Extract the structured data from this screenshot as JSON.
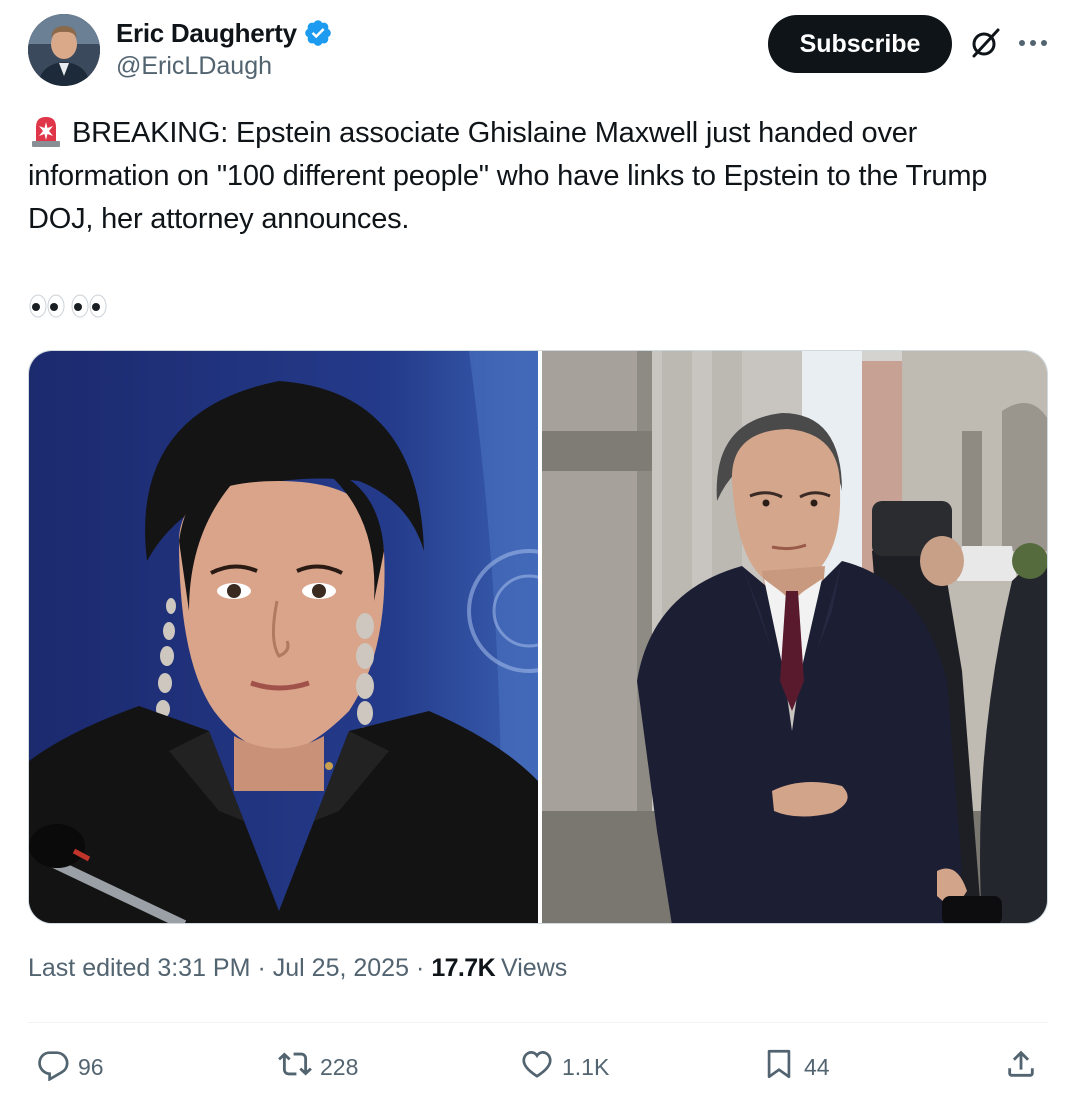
{
  "author": {
    "name": "Eric Daugherty",
    "handle": "@EricLDaugh",
    "verified": true
  },
  "header": {
    "subscribe_label": "Subscribe"
  },
  "tweet": {
    "text": "BREAKING: Epstein associate Ghislaine Maxwell just handed over information on \"100 different people\" who have links to Epstein to the Trump DOJ, her attorney announces.",
    "leading_emoji": "siren-icon",
    "trailing_emoji": [
      "eyes-icon",
      "eyes-icon"
    ]
  },
  "meta": {
    "edited_prefix": "Last edited",
    "time": "3:31 PM",
    "separator": "·",
    "date": "Jul 25, 2025",
    "views_count": "17.7K",
    "views_label": "Views"
  },
  "actions": {
    "replies": "96",
    "reposts": "228",
    "likes": "1.1K",
    "bookmarks": "44"
  },
  "colors": {
    "text_primary": "#0f1419",
    "text_secondary": "#536471",
    "verified_blue": "#1d9bf0",
    "subscribe_bg": "#0f1419",
    "divider": "#eff3f4"
  }
}
